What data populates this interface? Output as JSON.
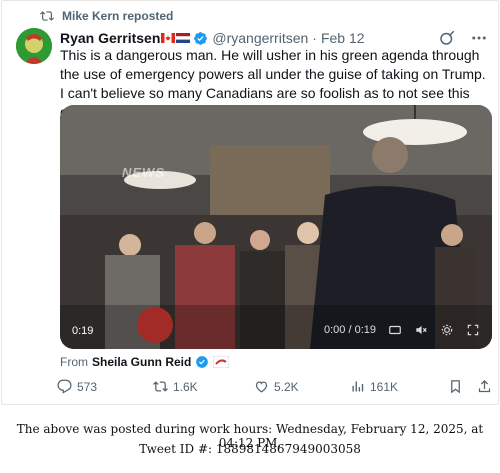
{
  "repost": {
    "label": "Mike Kern reposted"
  },
  "author": {
    "name": "Ryan Gerritsen",
    "handle": "@ryangerritsen",
    "date": "Feb 12"
  },
  "tweet": {
    "text": "This is a dangerous man. He will usher in his green agenda through the use of emergency powers all under the guise of taking on Trump. I can't believe so many Canadians are so foolish as to not see this guy for who he really is."
  },
  "video": {
    "watermark": "NEWS",
    "current_time": "0:19",
    "progress": "0:00 / 0:19"
  },
  "source": {
    "prefix": "From",
    "name": "Sheila Gunn Reid"
  },
  "actions": {
    "replies": "573",
    "reposts": "1.6K",
    "likes": "5.2K",
    "views": "161K"
  },
  "caption": {
    "line1": "The above was posted during work hours: Wednesday, February 12, 2025, at 04:12 PM.",
    "line2": "Tweet ID #: 1889814867949003058"
  },
  "colors": {
    "verified": "#1d9bf0",
    "muted": "#536471",
    "text": "#0f1419"
  },
  "icons": [
    "repost-icon",
    "verified-icon",
    "grok-icon",
    "more-icon",
    "reply-icon",
    "like-icon",
    "views-icon",
    "bookmark-icon",
    "share-icon"
  ]
}
